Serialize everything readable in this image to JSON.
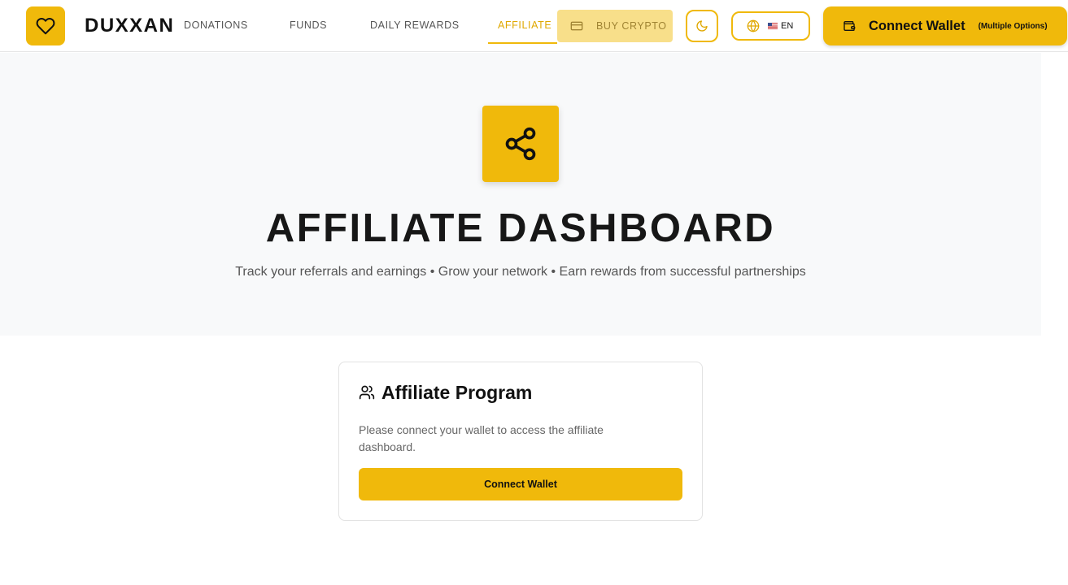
{
  "header": {
    "brand": "DUXXAN",
    "nav": [
      {
        "label": "DONATIONS"
      },
      {
        "label": "FUNDS"
      },
      {
        "label": "DAILY REWARDS"
      },
      {
        "label": "AFFILIATE",
        "active": true
      }
    ],
    "buy_crypto_label": "BUY CRYPTO",
    "language_code": "EN",
    "connect_wallet_label": "Connect Wallet",
    "connect_wallet_sub": "(Multiple Options)",
    "icons": {
      "logo": "heart-icon",
      "buy_crypto": "credit-card-icon",
      "theme": "moon-icon",
      "language": "globe-icon",
      "flag": "us-flag-icon",
      "wallet": "wallet-icon"
    }
  },
  "hero": {
    "icon": "share-icon",
    "title": "AFFILIATE DASHBOARD",
    "subtitle": "Track your referrals and earnings • Grow your network • Earn rewards from successful partnerships"
  },
  "card": {
    "icon": "users-icon",
    "title": "Affiliate Program",
    "description": "Please connect your wallet to access the affiliate dashboard.",
    "button_label": "Connect Wallet"
  },
  "colors": {
    "accent": "#f0b90b",
    "accent_light": "#f8df8a",
    "hero_bg": "#f8f9fa",
    "text_dark": "#171717",
    "text_muted": "#555555"
  }
}
